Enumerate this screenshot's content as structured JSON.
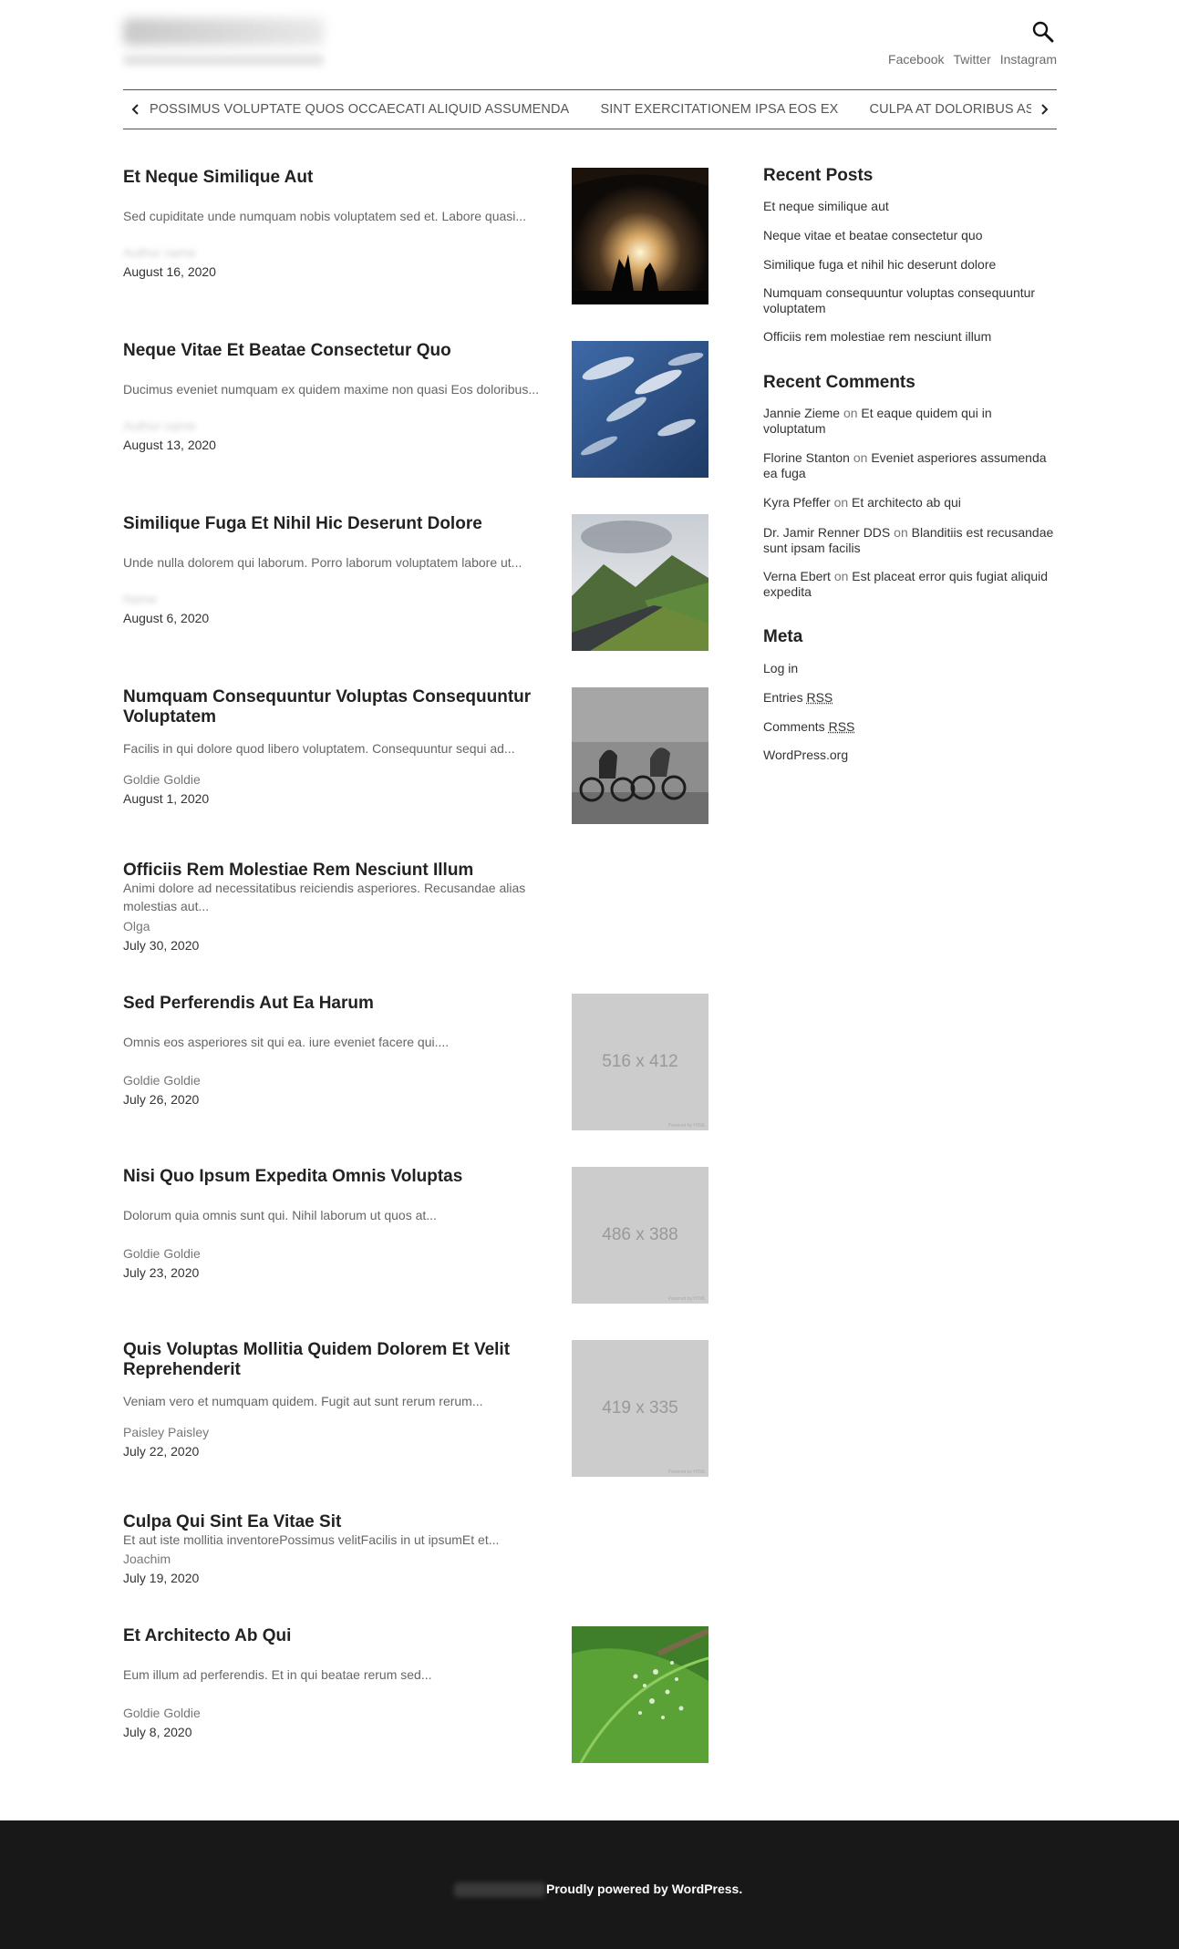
{
  "header": {
    "site_title": "Sitetitlehere.com",
    "site_description": "A site tagline description",
    "social": [
      "Facebook",
      "Twitter",
      "Instagram"
    ]
  },
  "ticker": {
    "items": [
      "POSSIMUS VOLUPTATE QUOS OCCAECATI ALIQUID ASSUMENDA",
      "SINT EXERCITATIONEM IPSA EOS EX",
      "CULPA AT DOLORIBUS ASPERNATUR"
    ]
  },
  "posts": [
    {
      "title": "Et Neque Similique Aut",
      "excerpt": "Sed cupiditate unde numquam nobis voluptatem sed et. Labore quasi...",
      "author": "Author name",
      "date": "August 16, 2020",
      "thumb": "concert"
    },
    {
      "title": "Neque Vitae Et Beatae Consectetur Quo",
      "excerpt": "Ducimus eveniet numquam ex quidem maxime non quasi Eos doloribus...",
      "author": "Author name",
      "date": "August 13, 2020",
      "thumb": "sky"
    },
    {
      "title": "Similique Fuga Et Nihil Hic Deserunt Dolore",
      "excerpt": "Unde nulla dolorem qui laborum. Porro laborum voluptatem labore ut...",
      "author": "Name",
      "date": "August 6, 2020",
      "thumb": "road"
    },
    {
      "title": "Numquam Consequuntur Voluptas Consequuntur Voluptatem",
      "excerpt": "Facilis in qui dolore quod libero voluptatem. Consequuntur sequi ad...",
      "author": "Goldie Goldie",
      "date": "August 1, 2020",
      "thumb": "cyclists"
    },
    {
      "title": "Officiis Rem Molestiae Rem Nesciunt Illum",
      "excerpt": "Animi dolore ad necessitatibus reiciendis asperiores. Recusandae alias molestias aut...",
      "author": "Olga",
      "date": "July 30, 2020",
      "thumb": "none"
    },
    {
      "title": "Sed Perferendis Aut Ea Harum",
      "excerpt": "Omnis eos asperiores sit qui ea. iure eveniet facere qui....",
      "author": "Goldie Goldie",
      "date": "July 26, 2020",
      "thumb": "placeholder",
      "placeholder": "516 x 412"
    },
    {
      "title": "Nisi Quo Ipsum Expedita Omnis Voluptas",
      "excerpt": "Dolorum quia omnis sunt qui. Nihil laborum ut quos at...",
      "author": "Goldie Goldie",
      "date": "July 23, 2020",
      "thumb": "placeholder",
      "placeholder": "486 x 388"
    },
    {
      "title": "Quis Voluptas Mollitia Quidem Dolorem Et Velit Reprehenderit",
      "excerpt": "Veniam vero et numquam quidem. Fugit aut sunt rerum rerum...",
      "author": "Paisley Paisley",
      "date": "July 22, 2020",
      "thumb": "placeholder",
      "placeholder": "419 x 335"
    },
    {
      "title": "Culpa Qui Sint Ea Vitae Sit",
      "excerpt": "Et aut iste mollitia inventorePossimus velitFacilis in ut ipsumEt et...",
      "author": "Joachim",
      "date": "July 19, 2020",
      "thumb": "none"
    },
    {
      "title": "Et Architecto Ab Qui",
      "excerpt": "Eum illum ad perferendis. Et in qui beatae rerum sed...",
      "author": "Goldie Goldie",
      "date": "July 8, 2020",
      "thumb": "leaf"
    }
  ],
  "sidebar": {
    "recent_posts_title": "Recent Posts",
    "recent_posts": [
      "Et neque similique aut",
      "Neque vitae et beatae consectetur quo",
      "Similique fuga et nihil hic deserunt dolore",
      "Numquam consequuntur voluptas consequuntur voluptatem",
      "Officiis rem molestiae rem nesciunt illum"
    ],
    "recent_comments_title": "Recent Comments",
    "recent_comments": [
      {
        "author": "Jannie Zieme",
        "on": "on",
        "post": "Et eaque quidem qui in voluptatum"
      },
      {
        "author": "Florine Stanton",
        "on": "on",
        "post": "Eveniet asperiores assumenda ea fuga"
      },
      {
        "author": "Kyra Pfeffer",
        "on": "on",
        "post": "Et architecto ab qui"
      },
      {
        "author": "Dr. Jamir Renner DDS",
        "on": "on",
        "post": "Blanditiis est recusandae sunt ipsam facilis"
      },
      {
        "author": "Verna Ebert",
        "on": "on",
        "post": "Est placeat error quis fugiat aliquid expedita"
      }
    ],
    "meta_title": "Meta",
    "meta": {
      "login": "Log in",
      "entries": "Entries",
      "comments": "Comments",
      "rss": "RSS",
      "wordpress": "WordPress.org"
    }
  },
  "footer": {
    "copyright": "© Site name",
    "powered": "Proudly powered by WordPress."
  }
}
